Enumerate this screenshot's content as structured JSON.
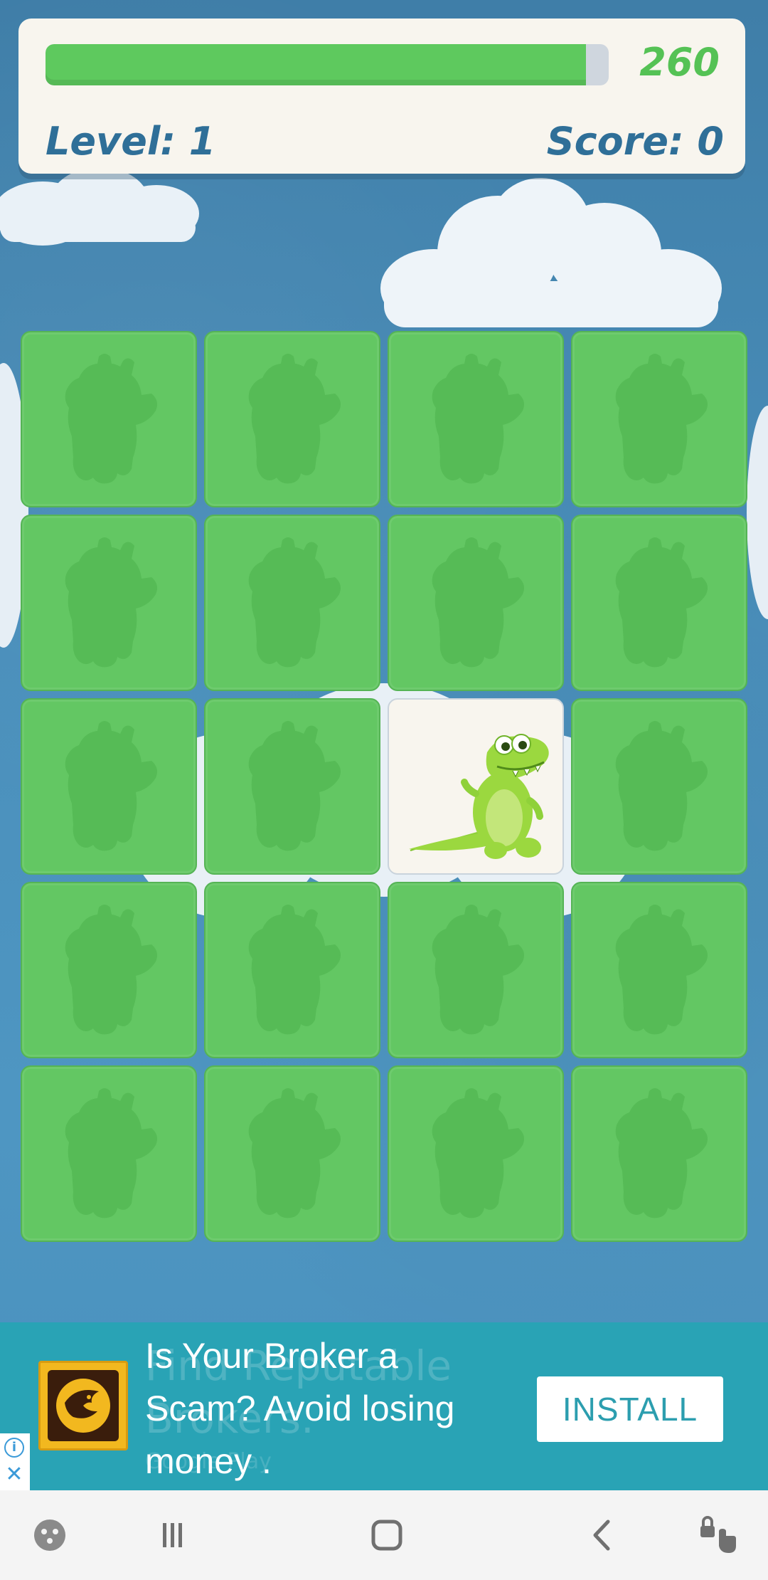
{
  "hud": {
    "timer_value": "260",
    "timer_progress": 0.96,
    "level_text": "Level: 1",
    "score_text": "Score: 0"
  },
  "board": {
    "rows": 5,
    "cols": 4,
    "cards": [
      {
        "state": "hidden"
      },
      {
        "state": "hidden"
      },
      {
        "state": "hidden"
      },
      {
        "state": "hidden"
      },
      {
        "state": "hidden"
      },
      {
        "state": "hidden"
      },
      {
        "state": "hidden"
      },
      {
        "state": "hidden"
      },
      {
        "state": "hidden"
      },
      {
        "state": "hidden"
      },
      {
        "state": "revealed",
        "icon": "crocodile-icon"
      },
      {
        "state": "hidden"
      },
      {
        "state": "hidden"
      },
      {
        "state": "hidden"
      },
      {
        "state": "hidden"
      },
      {
        "state": "hidden"
      },
      {
        "state": "hidden"
      },
      {
        "state": "hidden"
      },
      {
        "state": "hidden"
      },
      {
        "state": "hidden"
      }
    ],
    "card_back_icon": "hippo-silhouette-icon"
  },
  "ad": {
    "headline": "Is Your Broker a Scam? Avoid losing money .",
    "ghost_text": "Find Reputable Brokers.",
    "ghost_sub": "Google Play",
    "install_label": "INSTALL",
    "logo_icon": "eagle-logo-icon"
  },
  "colors": {
    "card_green": "#63c763",
    "timer_green": "#5ec95e",
    "label_blue": "#2f6f98",
    "ad_teal": "#29a3b5"
  },
  "navbar": {
    "icons": [
      "game-launcher-icon",
      "recent-apps-icon",
      "home-icon",
      "back-icon",
      "touch-lock-icon"
    ]
  }
}
